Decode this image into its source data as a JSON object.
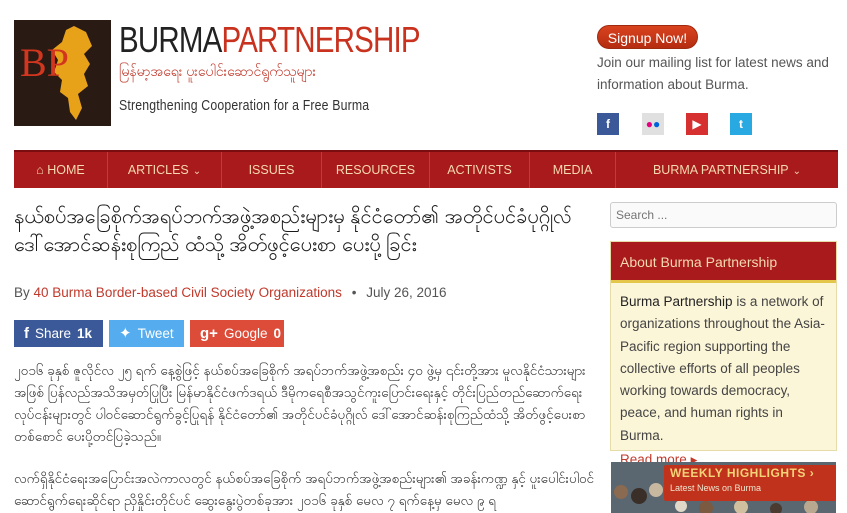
{
  "header": {
    "logo_letters": "BP",
    "logo_burma": "BURMA",
    "logo_partnership": "PARTNERSHIP",
    "logo_myanmar": "မြန်မာ့အရေး ပူးပေါင်းဆောင်ရွက်သူများ",
    "tagline": "Strengthening Cooperation for a Free Burma",
    "signup_label": "Signup Now!",
    "mailing_text": "Join our mailing list for latest news and information about Burma.",
    "social": [
      {
        "icon": "facebook-icon",
        "glyph": "f",
        "color": "#3b5998"
      },
      {
        "icon": "flickr-icon",
        "glyph": "●●",
        "color": "#e0e0e0"
      },
      {
        "icon": "youtube-icon",
        "glyph": "▶",
        "color": "#d63031"
      },
      {
        "icon": "twitter-icon",
        "glyph": "t",
        "color": "#29a9e1"
      }
    ]
  },
  "nav": {
    "home_icon": "home-icon",
    "items": [
      {
        "label": "HOME"
      },
      {
        "label": "ARTICLES"
      },
      {
        "label": "ISSUES"
      },
      {
        "label": "RESOURCES"
      },
      {
        "label": "ACTIVISTS"
      },
      {
        "label": "MEDIA"
      },
      {
        "label": "BURMA PARTNERSHIP"
      }
    ]
  },
  "article": {
    "title": "နယ်စပ်အခြေစိုက်အရပ်ဘက်အဖွဲ့အစည်းများမှ နိုင်ငံတော်၏ အတိုင်ပင်ခံပုဂ္ဂိုလ် ဒေါ်အောင်ဆန်းစုကြည် ထံသို့ အိတ်ဖွင့်ပေးစာ ပေးပို့ခြင်း",
    "byline_prefix": "By",
    "author": "40 Burma Border-based Civil Society Organizations",
    "date": "July 26, 2016",
    "share": {
      "facebook_label": "Share",
      "facebook_count": "1k",
      "twitter_label": "Tweet",
      "google_label": "Google",
      "google_count": "0"
    },
    "para1": "၂၀၁၆ ခုနှစ် ဇူလိုင်လ ၂၅ ရက် နေ့စွဲဖြင့် နယ်စပ်အခြေစိုက် အရပ်ဘက်အဖွဲ့အစည်း ၄၀ ဖွဲ့မှ ၎င်းတို့အား မူလနိုင်ငံသားများအဖြစ် ပြန်လည်အသိအမှတ်ပြုပြီး မြန်မာနိုင်ငံဖက်ဒရယ် ဒီမိုကရေစီအသွင်ကူးပြောင်းရေးနှင့် တိုင်းပြည်တည်ဆောက်ရေး လုပ်ငန်းများတွင် ပါဝင်ဆောင်ရွက်ခွင့်ပြုရန် နိုင်ငံတော်၏ အတိုင်ပင်ခံပုဂ္ဂိုလ် ဒေါ်အောင်ဆန်းစုကြည်ထံသို့ အိတ်ဖွင့်ပေးစာတစ်စောင် ပေးပို့တင်ပြခဲ့သည်။",
    "para2": "လက်ရှိနိုင်ငံရေးအပြောင်းအလဲကာလတွင် နယ်စပ်အခြေစိုက် အရပ်ဘက်အဖွဲ့အစည်းများ၏ အခန်းကဏ္ဍ နှင့် ပူးပေါင်းပါဝင်ဆောင်ရွက်ရေးဆိုင်ရာ ညှိနှိုင်းတိုင်ပင် ဆွေးနွေးပွဲတစ်ခုအား ၂၀၁၆ ခုနှစ် မေလ ၇ ရက်နေ့မှ မေလ ၉ ရ"
  },
  "sidebar": {
    "search_placeholder": "Search ...",
    "about_title": "About Burma Partnership",
    "about_bp": "Burma Partnership",
    "about_text": " is a network of organizations throughout the Asia-Pacific region supporting the collective efforts of all peoples working towards democracy, peace, and human rights in Burma.",
    "read_more": "Read more",
    "read_more_arrow": "▸",
    "weekly_title": "WEEKLY HIGHLIGHTS",
    "weekly_arrow": "›",
    "weekly_sub": "Latest News on Burma"
  },
  "colors": {
    "nav_bg": "#a81a1c",
    "nav_text": "#f5d9b0",
    "accent_red": "#c0392b",
    "about_bg": "#fcf6d9"
  }
}
